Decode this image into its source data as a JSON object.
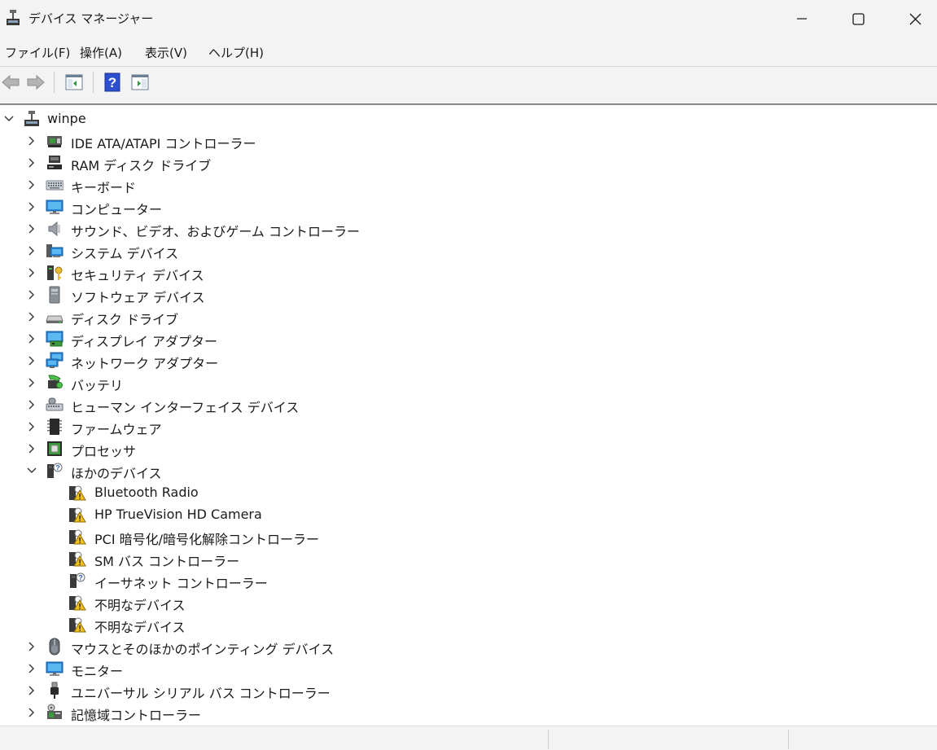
{
  "window": {
    "title": "デバイス マネージャー"
  },
  "menu": [
    "ファイル(F)",
    "操作(A)",
    "表示(V)",
    "ヘルプ(H)"
  ],
  "toolbar": {
    "icons": [
      "back-arrow-icon",
      "forward-arrow-icon",
      "properties-icon",
      "help-icon",
      "action-pane-icon"
    ]
  },
  "tree": {
    "root": "winpe",
    "categories": [
      {
        "label": "IDE ATA/ATAPI コントローラー",
        "icon": "ide-controller-icon",
        "expanded": false
      },
      {
        "label": "RAM ディスク ドライブ",
        "icon": "ram-disk-icon",
        "expanded": false
      },
      {
        "label": "キーボード",
        "icon": "keyboard-icon",
        "expanded": false
      },
      {
        "label": "コンピューター",
        "icon": "computer-icon",
        "expanded": false
      },
      {
        "label": "サウンド、ビデオ、およびゲーム コントローラー",
        "icon": "speaker-icon",
        "expanded": false
      },
      {
        "label": "システム デバイス",
        "icon": "system-device-icon",
        "expanded": false
      },
      {
        "label": "セキュリティ デバイス",
        "icon": "security-key-icon",
        "expanded": false
      },
      {
        "label": "ソフトウェア デバイス",
        "icon": "software-device-icon",
        "expanded": false
      },
      {
        "label": "ディスク ドライブ",
        "icon": "disk-drive-icon",
        "expanded": false
      },
      {
        "label": "ディスプレイ アダプター",
        "icon": "display-adapter-icon",
        "expanded": false
      },
      {
        "label": "ネットワーク アダプター",
        "icon": "network-adapter-icon",
        "expanded": false
      },
      {
        "label": "バッテリ",
        "icon": "battery-icon",
        "expanded": false
      },
      {
        "label": "ヒューマン インターフェイス デバイス",
        "icon": "hid-icon",
        "expanded": false
      },
      {
        "label": "ファームウェア",
        "icon": "firmware-icon",
        "expanded": false
      },
      {
        "label": "プロセッサ",
        "icon": "processor-icon",
        "expanded": false
      },
      {
        "label": "ほかのデバイス",
        "icon": "unknown-device-icon",
        "expanded": true
      },
      {
        "label": "マウスとそのほかのポインティング デバイス",
        "icon": "mouse-icon",
        "expanded": false
      },
      {
        "label": "モニター",
        "icon": "monitor-icon",
        "expanded": false
      },
      {
        "label": "ユニバーサル シリアル バス コントローラー",
        "icon": "usb-icon",
        "expanded": false
      },
      {
        "label": "記憶域コントローラー",
        "icon": "storage-controller-icon",
        "expanded": false
      }
    ],
    "other_devices": [
      {
        "label": "Bluetooth Radio",
        "icon": "warning-device-icon"
      },
      {
        "label": "HP TrueVision HD Camera",
        "icon": "warning-device-icon"
      },
      {
        "label": "PCI 暗号化/暗号化解除コントローラー",
        "icon": "warning-device-icon"
      },
      {
        "label": "SM バス コントローラー",
        "icon": "warning-device-icon"
      },
      {
        "label": "イーサネット コントローラー",
        "icon": "unknown-device-icon"
      },
      {
        "label": "不明なデバイス",
        "icon": "warning-device-icon"
      },
      {
        "label": "不明なデバイス",
        "icon": "warning-device-icon"
      }
    ]
  }
}
